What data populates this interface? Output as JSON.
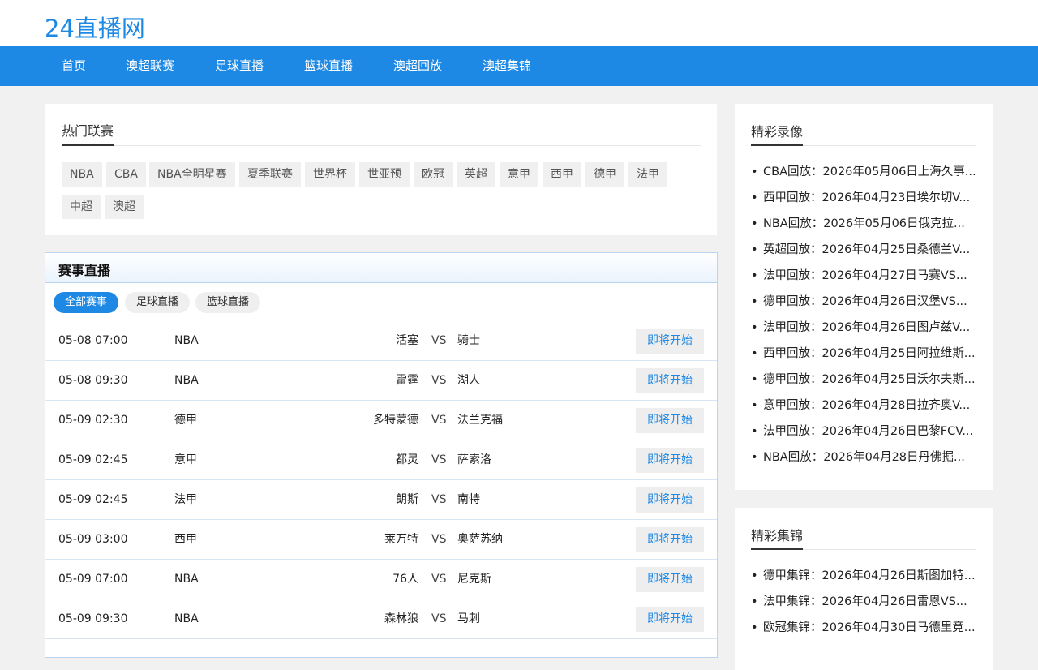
{
  "site": {
    "logo": "24直播网"
  },
  "nav": [
    "首页",
    "澳超联赛",
    "足球直播",
    "篮球直播",
    "澳超回放",
    "澳超集锦"
  ],
  "hot": {
    "title": "热门联赛",
    "tags": [
      "NBA",
      "CBA",
      "NBA全明星赛",
      "夏季联赛",
      "世界杯",
      "世亚预",
      "欧冠",
      "英超",
      "意甲",
      "西甲",
      "德甲",
      "法甲",
      "中超",
      "澳超"
    ]
  },
  "live": {
    "title": "赛事直播",
    "filters": [
      "全部赛事",
      "足球直播",
      "篮球直播"
    ],
    "matches": [
      {
        "time": "05-08 07:00",
        "league": "NBA",
        "home": "活塞",
        "vs": "VS",
        "away": "骑士",
        "status": "即将开始"
      },
      {
        "time": "05-08 09:30",
        "league": "NBA",
        "home": "雷霆",
        "vs": "VS",
        "away": "湖人",
        "status": "即将开始"
      },
      {
        "time": "05-09 02:30",
        "league": "德甲",
        "home": "多特蒙德",
        "vs": "VS",
        "away": "法兰克福",
        "status": "即将开始"
      },
      {
        "time": "05-09 02:45",
        "league": "意甲",
        "home": "都灵",
        "vs": "VS",
        "away": "萨索洛",
        "status": "即将开始"
      },
      {
        "time": "05-09 02:45",
        "league": "法甲",
        "home": "朗斯",
        "vs": "VS",
        "away": "南特",
        "status": "即将开始"
      },
      {
        "time": "05-09 03:00",
        "league": "西甲",
        "home": "莱万特",
        "vs": "VS",
        "away": "奥萨苏纳",
        "status": "即将开始"
      },
      {
        "time": "05-09 07:00",
        "league": "NBA",
        "home": "76人",
        "vs": "VS",
        "away": "尼克斯",
        "status": "即将开始"
      },
      {
        "time": "05-09 09:30",
        "league": "NBA",
        "home": "森林狼",
        "vs": "VS",
        "away": "马刺",
        "status": "即将开始"
      }
    ]
  },
  "replays": {
    "title": "精彩录像",
    "items": [
      "CBA回放：2026年05月06日上海久事...",
      "西甲回放：2026年04月23日埃尔切V...",
      "NBA回放：2026年05月06日俄克拉...",
      "英超回放：2026年04月25日桑德兰V...",
      "法甲回放：2026年04月27日马赛VS...",
      "德甲回放：2026年04月26日汉堡VS...",
      "法甲回放：2026年04月26日图卢兹V...",
      "西甲回放：2026年04月25日阿拉维斯...",
      "德甲回放：2026年04月25日沃尔夫斯...",
      "意甲回放：2026年04月28日拉齐奥V...",
      "法甲回放：2026年04月26日巴黎FCV...",
      "NBA回放：2026年04月28日丹佛掘..."
    ]
  },
  "highlights": {
    "title": "精彩集锦",
    "items": [
      "德甲集锦：2026年04月26日斯图加特...",
      "法甲集锦：2026年04月26日雷恩VS...",
      "欧冠集锦：2026年04月30日马德里竞..."
    ]
  },
  "bullet": "•",
  "colors": {
    "brand": "#1e88e5",
    "background": "#f1f1f1"
  }
}
